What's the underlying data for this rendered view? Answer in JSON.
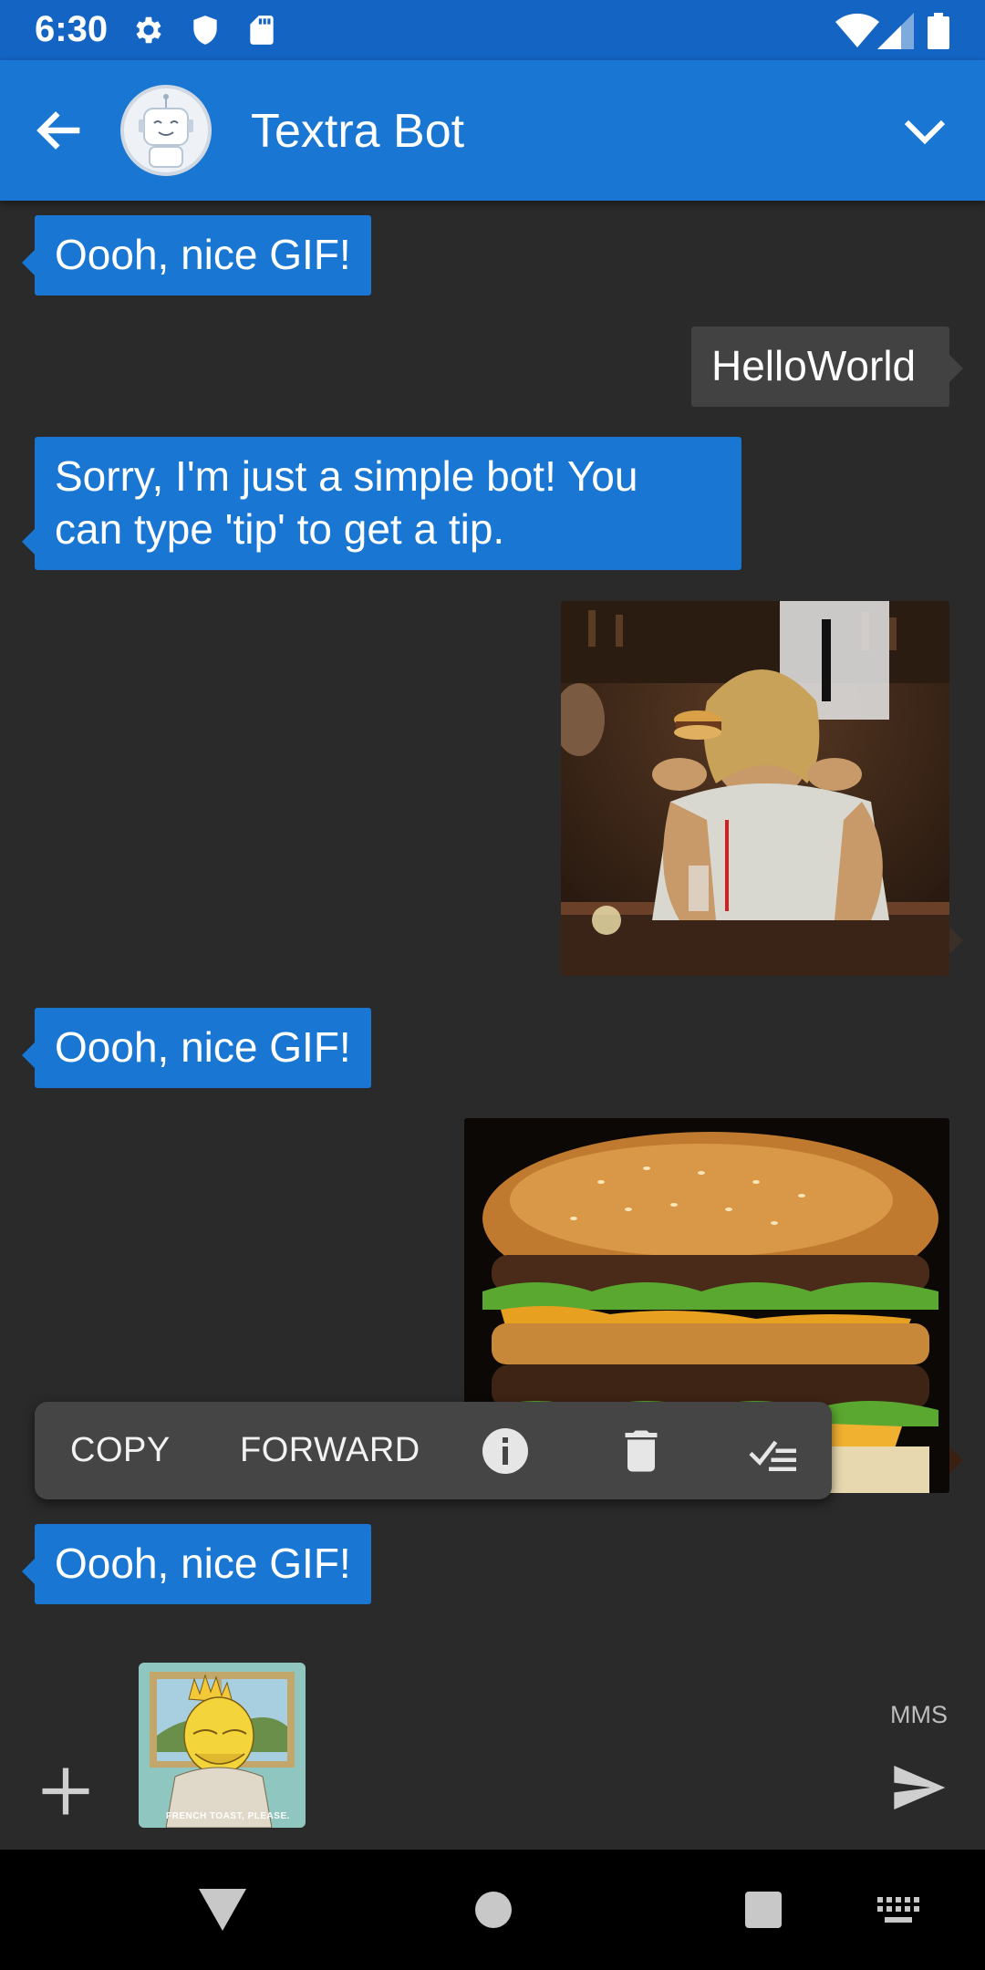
{
  "status_bar": {
    "time": "6:30",
    "left_icons": [
      "settings-icon",
      "shield-icon",
      "sd-card-icon"
    ],
    "right_icons": [
      "wifi-icon",
      "cell-signal-icon",
      "battery-icon"
    ]
  },
  "app_bar": {
    "title": "Textra Bot",
    "back_icon": "arrow-back-icon",
    "avatar": "robot-avatar",
    "expand_icon": "chevron-down-icon",
    "color": "#1976d2"
  },
  "messages": [
    {
      "direction": "in",
      "type": "text",
      "text": "Oooh, nice GIF!"
    },
    {
      "direction": "out",
      "type": "text",
      "text": "HelloWorld"
    },
    {
      "direction": "in",
      "type": "text",
      "lines": [
        "Sorry, I'm just a simple bot! You",
        "can type 'tip' to get a tip."
      ]
    },
    {
      "direction": "out",
      "type": "gif",
      "subject": "woman eating a burger"
    },
    {
      "direction": "in",
      "type": "text",
      "text": "Oooh, nice GIF!"
    },
    {
      "direction": "out",
      "type": "gif",
      "subject": "cheeseburger close-up"
    },
    {
      "direction": "in",
      "type": "text",
      "text": "Oooh, nice GIF!"
    }
  ],
  "context_menu": {
    "copy_label": "COPY",
    "forward_label": "FORWARD",
    "icons": [
      "info-icon",
      "delete-icon",
      "select-all-icon"
    ]
  },
  "composer": {
    "attachment": {
      "type": "gif",
      "caption": "FRENCH TOAST, PLEASE."
    },
    "mode_label": "MMS",
    "add_icon": "plus-icon",
    "send_icon": "send-icon"
  },
  "nav_bar": {
    "icons": [
      "back-triangle-icon",
      "home-circle-icon",
      "recents-square-icon",
      "keyboard-icon"
    ]
  },
  "colors": {
    "incoming_bubble": "#1976d2",
    "outgoing_bubble": "#424242",
    "background": "#2a2a2a",
    "status_bar": "#1464c4"
  }
}
